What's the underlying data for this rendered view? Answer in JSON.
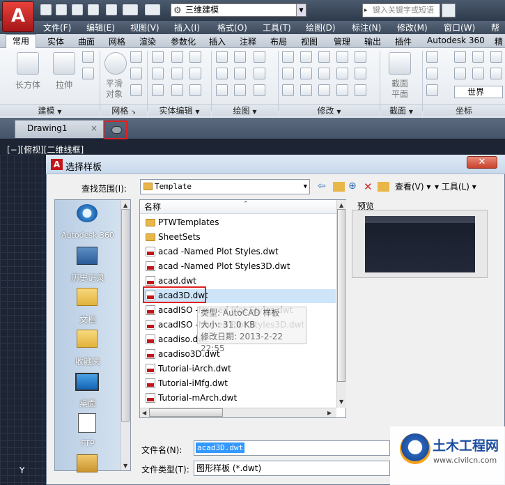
{
  "app": {
    "workspace": "三维建模",
    "keyword_placeholder": "键入关键字或短语"
  },
  "menu": [
    "文件(F)",
    "编辑(E)",
    "视图(V)",
    "插入(I)",
    "格式(O)",
    "工具(T)",
    "绘图(D)",
    "标注(N)",
    "修改(M)",
    "窗口(W)",
    "帮助"
  ],
  "ribbon_tabs": [
    "常用",
    "实体",
    "曲面",
    "网格",
    "渲染",
    "参数化",
    "插入",
    "注释",
    "布局",
    "视图",
    "管理",
    "输出",
    "插件",
    "Autodesk 360",
    "精"
  ],
  "ribbon": {
    "big_buttons": [
      "长方体",
      "拉伸",
      "平滑\n对象",
      "截面\n平面"
    ],
    "world_label": "世界",
    "panels": [
      "建模",
      "网格",
      "实体编辑",
      "绘图",
      "修改",
      "截面",
      "坐标"
    ]
  },
  "doc_tab": {
    "name": "Drawing1",
    "close": "×"
  },
  "viewport_label": "[−][俯视][二维线框]",
  "dialog": {
    "title": "选择样板",
    "close": "✕",
    "look_in_label": "查找范围(I):",
    "look_in_value": "Template",
    "toolbar": {
      "views": "查看(V)",
      "tools": "工具(L)"
    },
    "places": [
      "Autodesk 360",
      "历史记录",
      "文档",
      "收藏夹",
      "桌面",
      "FTP"
    ],
    "list_header": "名称",
    "files": [
      {
        "name": "PTWTemplates",
        "type": "folder"
      },
      {
        "name": "SheetSets",
        "type": "folder"
      },
      {
        "name": "acad -Named Plot Styles.dwt",
        "type": "dwt"
      },
      {
        "name": "acad -Named Plot Styles3D.dwt",
        "type": "dwt"
      },
      {
        "name": "acad.dwt",
        "type": "dwt"
      },
      {
        "name": "acad3D.dwt",
        "type": "dwt",
        "selected": true
      },
      {
        "name": "acadISO -Named Plot Styles.dwt",
        "type": "dwt"
      },
      {
        "name": "acadISO -Named Plot Styles3D.dwt",
        "type": "dwt"
      },
      {
        "name": "acadiso.dwt",
        "type": "dwt"
      },
      {
        "name": "acadiso3D.dwt",
        "type": "dwt"
      },
      {
        "name": "Tutorial-iArch.dwt",
        "type": "dwt"
      },
      {
        "name": "Tutorial-iMfg.dwt",
        "type": "dwt"
      },
      {
        "name": "Tutorial-mArch.dwt",
        "type": "dwt"
      }
    ],
    "tooltip": [
      "类型: AutoCAD 样板",
      "大小: 31.0 KB",
      "修改日期: 2013-2-22 22:55"
    ],
    "preview_label": "预览",
    "filename_label": "文件名(N):",
    "filename_value": "acad3D.dwt",
    "filetype_label": "文件类型(T):",
    "filetype_value": "图形样板 (*.dwt)"
  },
  "watermark": {
    "title": "土木工程网",
    "url": "www.civilcn.com"
  },
  "colors": {
    "highlight_box": "#e02020",
    "selection": "#cde4f9",
    "autocad_red": "#c2161b"
  }
}
